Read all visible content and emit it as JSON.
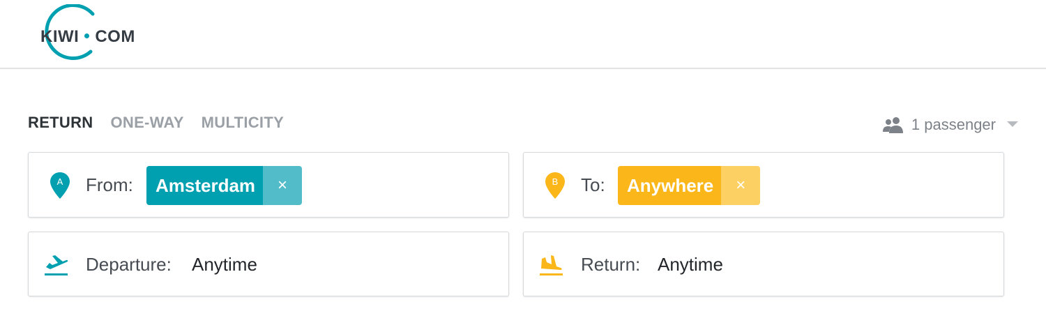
{
  "header": {
    "logo": {
      "left": "KIWI",
      "right": "COM"
    }
  },
  "trip_types": [
    {
      "label": "RETURN",
      "active": true
    },
    {
      "label": "ONE-WAY",
      "active": false
    },
    {
      "label": "MULTICITY",
      "active": false
    }
  ],
  "passengers": {
    "label": "1 passenger",
    "icon": "people-icon"
  },
  "search": {
    "from": {
      "pin_letter": "A",
      "label": "From:",
      "chip": "Amsterdam",
      "remove_symbol": "×"
    },
    "to": {
      "pin_letter": "B",
      "label": "To:",
      "chip": "Anywhere",
      "remove_symbol": "×"
    },
    "departure": {
      "label": "Departure:",
      "value": "Anytime",
      "icon": "plane-takeoff-icon"
    },
    "return": {
      "label": "Return:",
      "value": "Anytime",
      "icon": "plane-landing-icon"
    }
  },
  "colors": {
    "brand_teal": "#00a0b0",
    "brand_orange": "#fbb719",
    "text_dark": "#2e3337",
    "text_muted": "#9aa0a6"
  }
}
